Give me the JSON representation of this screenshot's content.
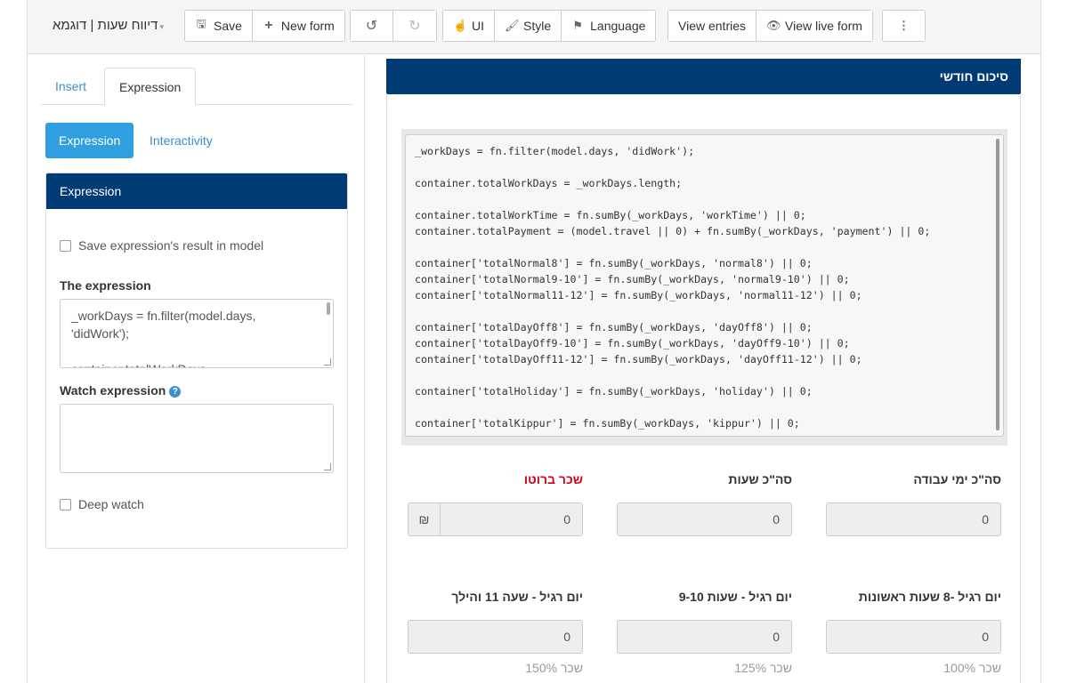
{
  "header": {
    "form_title": "דיווח שעות | דוגמא",
    "save_label": "Save",
    "new_form_label": "New form",
    "ui_label": "UI",
    "style_label": "Style",
    "language_label": "Language",
    "view_entries_label": "View entries",
    "view_live_form_label": "View live form"
  },
  "left_panel": {
    "tabs": [
      {
        "label": "Insert"
      },
      {
        "label": "Expression"
      }
    ],
    "pills": [
      {
        "label": "Expression"
      },
      {
        "label": "Interactivity"
      }
    ],
    "panel_title": "Expression",
    "save_result_label": "Save expression's result in model",
    "expression_label": "The expression",
    "expression_value": "_workDays = fn.filter(model.days, 'didWork');\n\ncontainer.totalWorkDays",
    "watch_label": "Watch expression",
    "watch_value": "",
    "deep_watch_label": "Deep watch"
  },
  "right_panel": {
    "section_title": "סיכום חודשי",
    "code": "_workDays = fn.filter(model.days, 'didWork');\n\ncontainer.totalWorkDays = _workDays.length;\n\ncontainer.totalWorkTime = fn.sumBy(_workDays, 'workTime') || 0;\ncontainer.totalPayment = (model.travel || 0) + fn.sumBy(_workDays, 'payment') || 0;\n\ncontainer['totalNormal8'] = fn.sumBy(_workDays, 'normal8') || 0;\ncontainer['totalNormal9-10'] = fn.sumBy(_workDays, 'normal9-10') || 0;\ncontainer['totalNormal11-12'] = fn.sumBy(_workDays, 'normal11-12') || 0;\n\ncontainer['totalDayOff8'] = fn.sumBy(_workDays, 'dayOff8') || 0;\ncontainer['totalDayOff9-10'] = fn.sumBy(_workDays, 'dayOff9-10') || 0;\ncontainer['totalDayOff11-12'] = fn.sumBy(_workDays, 'dayOff11-12') || 0;\n\ncontainer['totalHoliday'] = fn.sumBy(_workDays, 'holiday') || 0;\n\ncontainer['totalKippur'] = fn.sumBy(_workDays, 'kippur') || 0;",
    "fields": {
      "total_work_days": {
        "label": "סה\"כ ימי עבודה",
        "value": "0"
      },
      "total_hours": {
        "label": "סה\"כ שעות",
        "value": "0"
      },
      "gross_pay": {
        "label": "שכר ברוטו",
        "value": "0",
        "addon": "₪"
      },
      "regular_8": {
        "label": "יום רגיל -8 שעות ראשונות",
        "value": "0",
        "hint": "100% שכר"
      },
      "regular_9_10": {
        "label": "יום רגיל - שעות 9-10",
        "value": "0",
        "hint": "125% שכר"
      },
      "regular_11_up": {
        "label": "יום רגיל - שעה 11 והילך",
        "value": "0",
        "hint": "150% שכר"
      }
    },
    "colors": {
      "header_bg": "#003b75",
      "accent": "#2f9fe0",
      "required_label": "#d0021b"
    }
  }
}
